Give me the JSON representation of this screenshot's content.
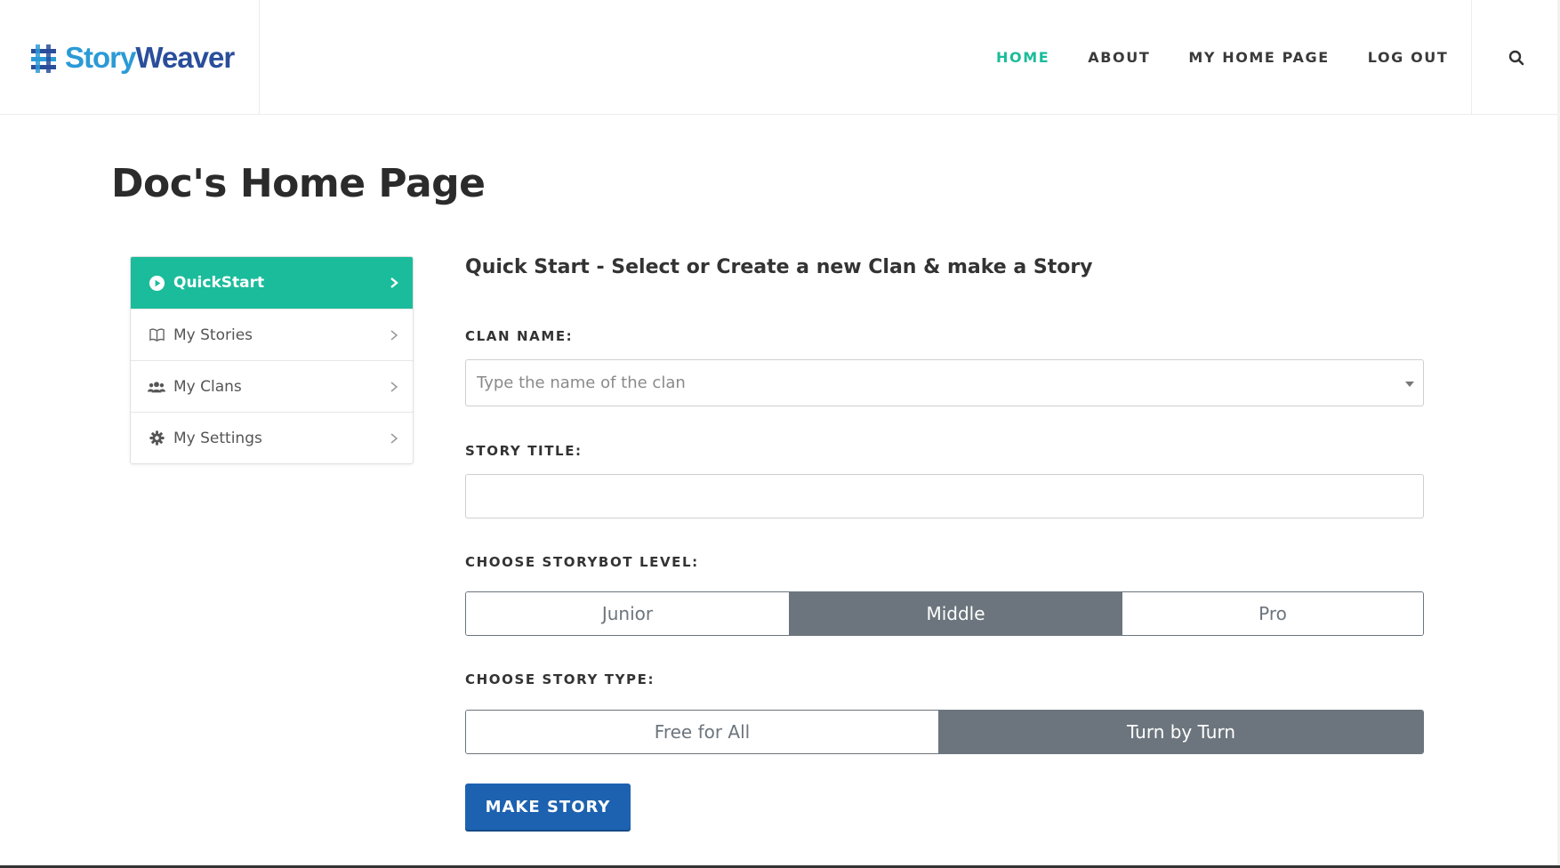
{
  "header": {
    "logo": {
      "part1": "Story",
      "part2": "Weaver"
    },
    "nav": [
      {
        "label": "HOME",
        "active": true
      },
      {
        "label": "ABOUT",
        "active": false
      },
      {
        "label": "MY HOME PAGE",
        "active": false
      },
      {
        "label": "LOG OUT",
        "active": false
      }
    ],
    "search_icon": "search-icon"
  },
  "page": {
    "title": "Doc's Home Page"
  },
  "sidebar": {
    "items": [
      {
        "label": "QuickStart",
        "icon": "play-circle-icon",
        "active": true
      },
      {
        "label": "My Stories",
        "icon": "book-icon",
        "active": false
      },
      {
        "label": "My Clans",
        "icon": "users-icon",
        "active": false
      },
      {
        "label": "My Settings",
        "icon": "gear-icon",
        "active": false
      }
    ]
  },
  "form": {
    "heading": "Quick Start - Select or Create a new Clan & make a Story",
    "clan_name": {
      "label": "CLAN NAME:",
      "placeholder": "Type the name of the clan"
    },
    "story_title": {
      "label": "STORY TITLE:",
      "value": ""
    },
    "storybot_level": {
      "label": "CHOOSE STORYBOT LEVEL:",
      "options": [
        "Junior",
        "Middle",
        "Pro"
      ],
      "selected": "Middle"
    },
    "story_type": {
      "label": "CHOOSE STORY TYPE:",
      "options": [
        "Free for All",
        "Turn by Turn"
      ],
      "selected": "Turn by Turn"
    },
    "submit_label": "MAKE STORY"
  },
  "colors": {
    "accent": "#1bbc9b",
    "primary_button": "#1d62b0",
    "segment_selected": "#6c757d",
    "logo_story": "#2b9ad6",
    "logo_weaver": "#2a4e9b"
  }
}
